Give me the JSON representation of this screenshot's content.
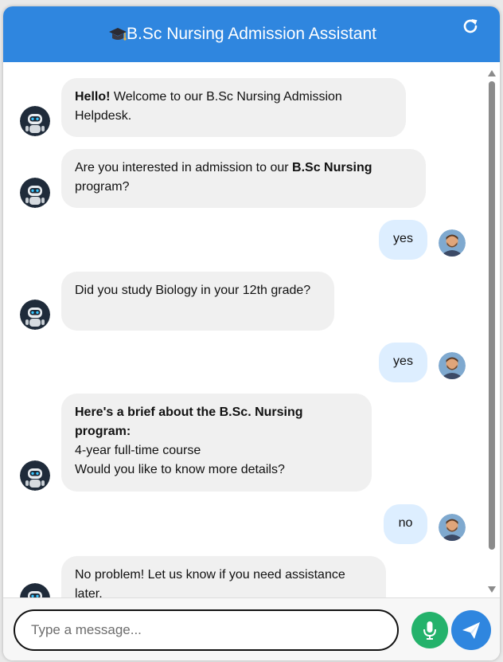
{
  "header": {
    "title": "B.Sc Nursing Admission Assistant",
    "cap_icon": "graduation-cap-icon",
    "refresh_icon": "refresh-icon"
  },
  "colors": {
    "header_bg": "#2f86df",
    "bot_bubble": "#f0f0f0",
    "user_bubble": "#ddeeff",
    "mic_button": "#24b26b",
    "send_button": "#2f86df"
  },
  "messages": [
    {
      "sender": "bot",
      "bold": "Hello!",
      "text": " Welcome to our B.Sc Nursing Admission Helpdesk."
    },
    {
      "sender": "bot",
      "text": "Are you interested in admission to our ",
      "bold": "B.Sc Nursing",
      "text_after": " program?"
    },
    {
      "sender": "user",
      "text": "yes"
    },
    {
      "sender": "bot",
      "text": "Did you study Biology in your 12th grade?"
    },
    {
      "sender": "user",
      "text": "yes"
    },
    {
      "sender": "bot",
      "bold": "Here's a brief about the B.Sc. Nursing program:",
      "line2": "4-year full-time course",
      "line3": "Would you like to know more details?"
    },
    {
      "sender": "user",
      "text": "no"
    },
    {
      "sender": "bot",
      "text": "No problem! Let us know if you need assistance later."
    }
  ],
  "input": {
    "placeholder": "Type a message...",
    "value": ""
  },
  "buttons": {
    "mic_icon": "microphone-icon",
    "send_icon": "send-icon"
  }
}
